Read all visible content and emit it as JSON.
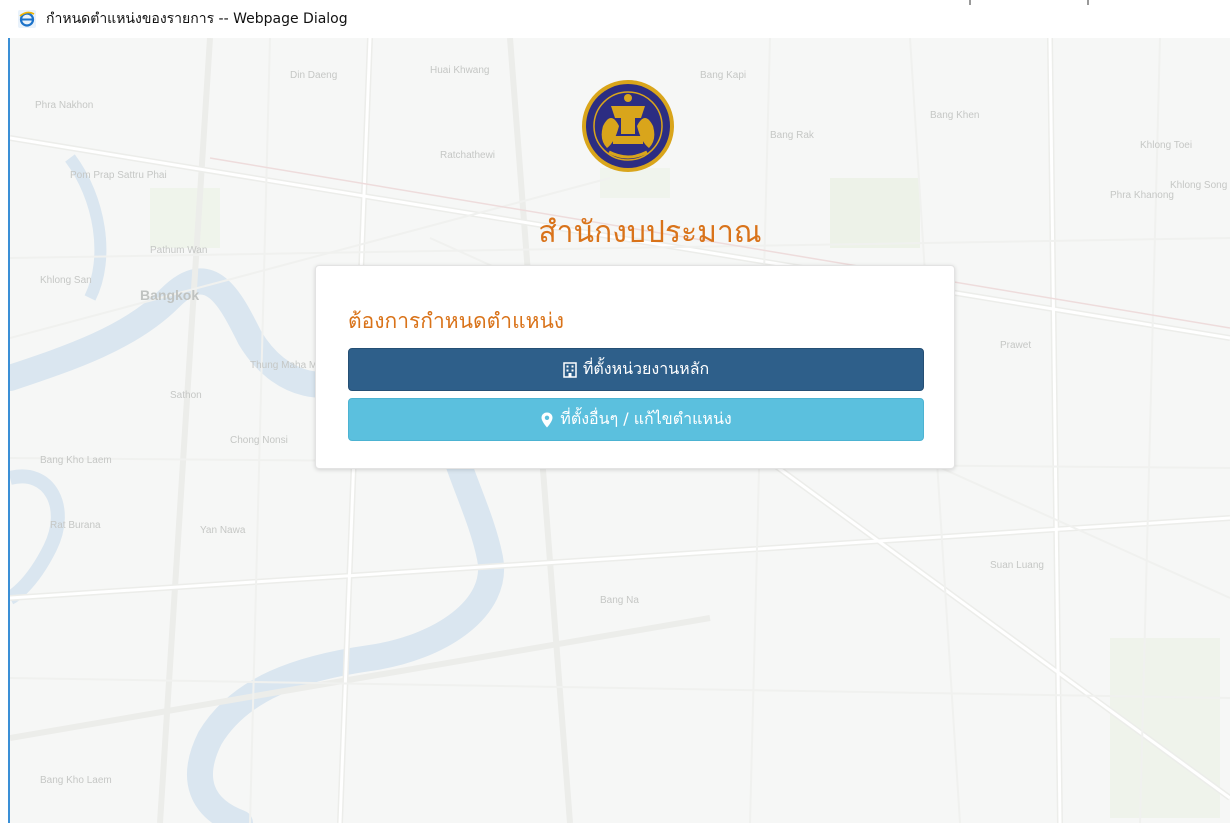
{
  "window": {
    "title": "กำหนดตำแหน่งของรายการ -- Webpage Dialog",
    "icon": "internet-explorer-icon"
  },
  "header": {
    "org_name": "สำนักงบประมาณ",
    "emblem": "thai-budget-bureau-emblem"
  },
  "card": {
    "heading": "ต้องการกำหนดตำแหน่ง",
    "buttons": [
      {
        "label": "ที่ตั้งหน่วยงานหลัก",
        "icon": "building-icon",
        "color": "#2e5f8a"
      },
      {
        "label": "ที่ตั้งอื่นๆ / แก้ไขตำแหน่ง",
        "icon": "map-marker-icon",
        "color": "#5bc0de"
      }
    ]
  },
  "map_labels": [
    "Bangkok",
    "Bang Kapi",
    "Huai Khwang",
    "Din Daeng",
    "Phra Nakhon",
    "Pom Prap Sattru Phai",
    "Pathum Wan",
    "Khlong San",
    "Bang Kho Laem",
    "Yan Nawa",
    "Thung Maha Mek",
    "Khlong Toei",
    "Prawet",
    "Phra Khanong",
    "Bang Na",
    "Bang Kho Laem",
    "Rat Burana",
    "Chong Nonsi",
    "Sathon",
    "Khlong Song Ton Nun",
    "Suan Luang",
    "Bang Khen",
    "Bang Rak",
    "Ratchathewi"
  ],
  "colors": {
    "accent": "#d9731a",
    "primary": "#2e5f8a",
    "info": "#5bc0de"
  }
}
